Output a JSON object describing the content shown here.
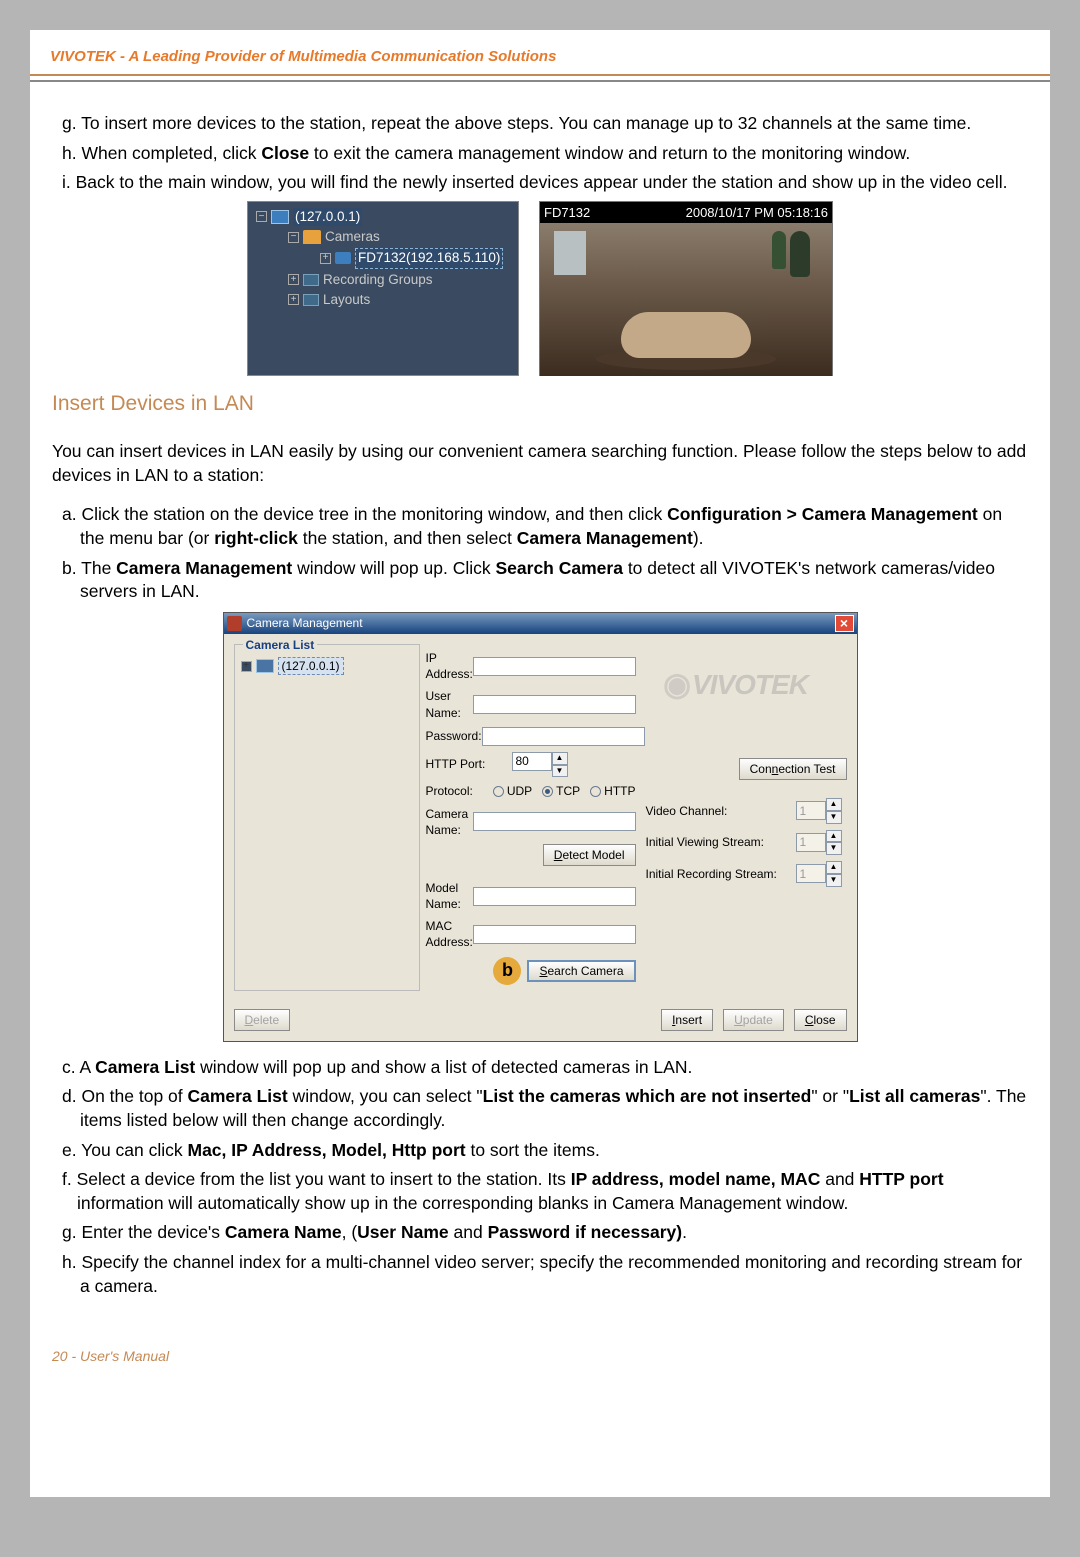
{
  "header": {
    "text": "VIVOTEK - A Leading Provider of Multimedia Communication Solutions"
  },
  "intro_steps": {
    "g": "g. To insert more devices to the station, repeat the above steps. You can manage up to 32 channels at the same time.",
    "h_pre": "h. When completed, click ",
    "h_bold": "Close",
    "h_post": " to exit the camera management window and return to the monitoring window.",
    "i": "i. Back to the main window, you will find the newly inserted devices appear under the station and show up in the video cell."
  },
  "tree_panel": {
    "root_ip": "(127.0.0.1)",
    "cameras_label": "Cameras",
    "camera_entry": "FD7132(192.168.5.110)",
    "recording_groups": "Recording Groups",
    "layouts": "Layouts"
  },
  "video": {
    "model": "FD7132",
    "timestamp": "2008/10/17 PM 05:18:16"
  },
  "section_title": "Insert Devices in LAN",
  "lan_intro": "You can insert devices in LAN easily by using our convenient camera searching function. Please follow the steps below to add devices in LAN to a station:",
  "lan_steps_a": {
    "pre": "a. Click the station on the device tree in the monitoring window, and then click ",
    "b1": "Configuration > Camera Management",
    "mid1": " on the menu bar (or ",
    "b2": "right-click",
    "mid2": " the station, and then select ",
    "b3": "Camera Management",
    "post": ")."
  },
  "lan_steps_b": {
    "pre": "b. The ",
    "b1": "Camera Management",
    "mid1": " window will pop up. Click ",
    "b2": "Search Camera",
    "post": " to detect all VIVOTEK's network cameras/video servers in LAN."
  },
  "dialog": {
    "title": "Camera Management",
    "camlist_legend": "Camera List",
    "camlist_ip": "(127.0.0.1)",
    "labels": {
      "ip": "IP Address:",
      "user": "User Name:",
      "pass": "Password:",
      "httpport": "HTTP Port:",
      "protocol": "Protocol:",
      "camname": "Camera Name:",
      "model": "Model Name:",
      "mac": "MAC Address:",
      "vchannel": "Video Channel:",
      "ivs": "Initial Viewing Stream:",
      "irs": "Initial Recording Stream:"
    },
    "httpport_value": "80",
    "protocols": {
      "udp": "UDP",
      "tcp": "TCP",
      "http": "HTTP"
    },
    "buttons": {
      "detect_model": "Detect Model",
      "conn_test": "Connection Test",
      "search_camera": "Search Camera",
      "delete": "Delete",
      "insert": "Insert",
      "update": "Update",
      "close": "Close"
    },
    "readonly_one": "1",
    "circle_b": "b",
    "logo": "VIVOTEK"
  },
  "steps_after": {
    "c_pre": "c. A ",
    "c_bold": "Camera List",
    "c_post": " window will pop up and show a list of detected cameras in LAN.",
    "d_pre": "d. On the top of ",
    "d_b1": "Camera List",
    "d_mid1": " window, you can select \"",
    "d_b2": "List the cameras which are not inserted",
    "d_mid2": "\" or \"",
    "d_b3": "List all cameras",
    "d_post": "\". The items listed below will then change accordingly.",
    "e_pre": "e. You can click ",
    "e_bold": "Mac, IP Address, Model, Http port",
    "e_post": " to sort the items.",
    "f_pre": "f. Select a device from the list you want to insert to the station. Its ",
    "f_b1": "IP address, model name, MAC",
    "f_mid1": " and ",
    "f_b2": "HTTP port",
    "f_post": " information will automatically show up in the corresponding blanks in Camera Management window.",
    "g_pre": "g. Enter the device's ",
    "g_b1": "Camera Name",
    "g_mid1": ", (",
    "g_b2": "User Name",
    "g_mid2": " and ",
    "g_b3": "Password if necessary)",
    "g_post": ".",
    "h": "h. Specify the channel index for a multi-channel video server; specify the recommended monitoring and recording stream for a camera."
  },
  "footer": {
    "left": "20 - User's Manual"
  }
}
